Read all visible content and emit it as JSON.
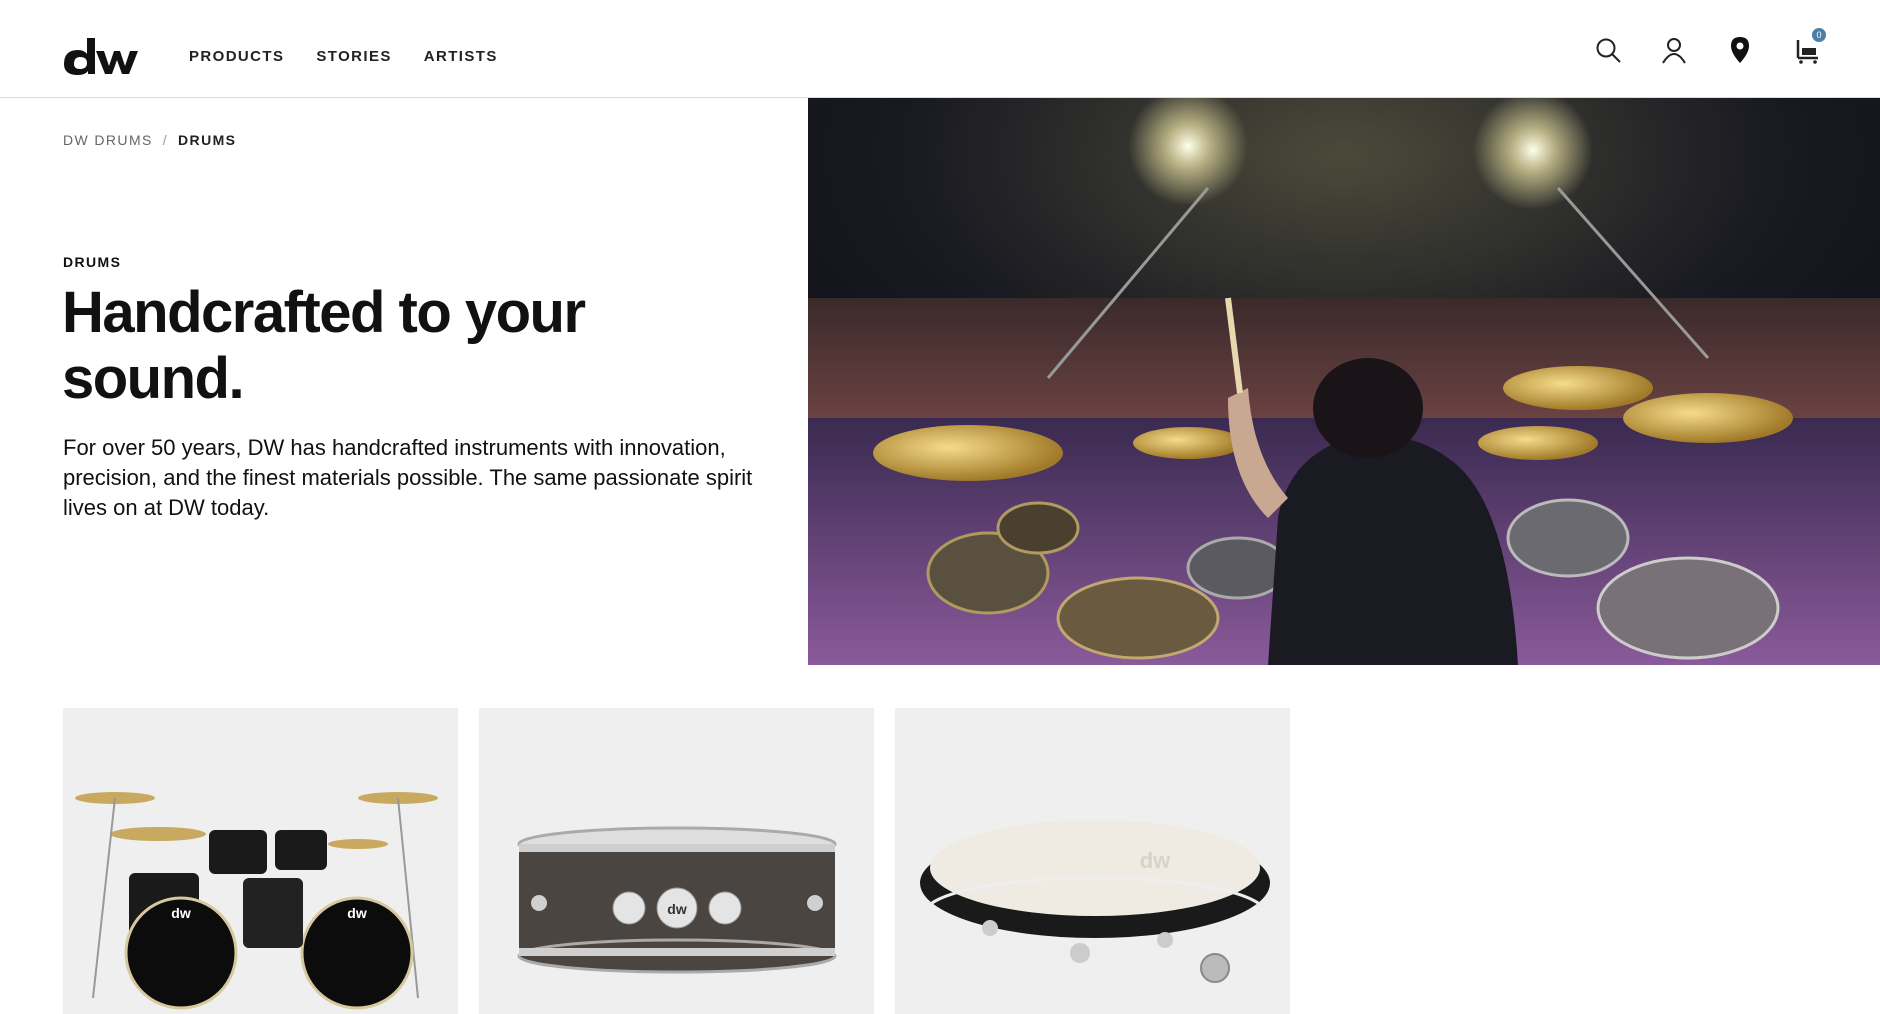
{
  "header": {
    "logo_alt": "dw",
    "nav": [
      {
        "label": "PRODUCTS"
      },
      {
        "label": "STORIES"
      },
      {
        "label": "ARTISTS"
      }
    ],
    "icons": [
      "search-icon",
      "account-icon",
      "location-pin-icon",
      "cart-icon"
    ],
    "cart_count": "0"
  },
  "breadcrumb": {
    "root": "DW DRUMS",
    "separator": "/",
    "current": "DRUMS"
  },
  "hero": {
    "eyebrow": "DRUMS",
    "title": "Handcrafted to your sound.",
    "description": "For over 50 years, DW has handcrafted instruments with innovation, precision, and the finest materials possible. The same passionate spirit lives on at DW today."
  },
  "cards": [
    {
      "name": "drum-kit"
    },
    {
      "name": "snare-drum"
    },
    {
      "name": "bass-drum"
    }
  ],
  "colors": {
    "badge": "#4b7fa6",
    "card_bg": "#f0eff0"
  }
}
